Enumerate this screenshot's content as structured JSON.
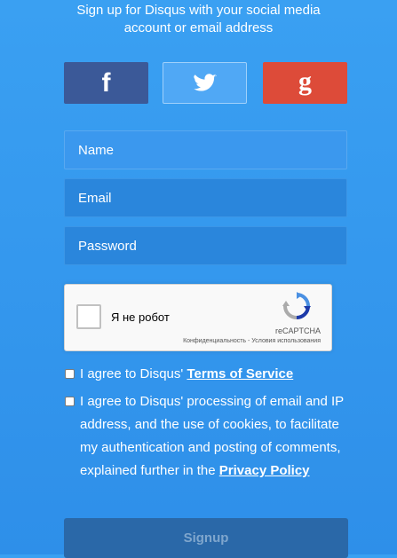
{
  "heading": {
    "line1": "Sign up for Disqus with your social media",
    "line2": "account or email address"
  },
  "social": {
    "facebook": {
      "glyph": "f",
      "icon": "facebook-icon",
      "color": "#3b5998"
    },
    "twitter": {
      "icon": "twitter-bird-icon",
      "color": "#50a8f5"
    },
    "google": {
      "glyph": "g",
      "icon": "google-plus-icon",
      "color": "#dd4b39"
    }
  },
  "form": {
    "name_placeholder": "Name",
    "email_placeholder": "Email",
    "password_placeholder": "Password"
  },
  "captcha": {
    "label": "Я не робот",
    "brand": "reCAPTCHA",
    "links": "Конфиденциальность - Условия использования"
  },
  "agreements": {
    "tos_prefix": "I agree to Disqus' ",
    "tos_link": "Terms of Service",
    "privacy_prefix": "I agree to Disqus' processing of email and IP address, and the use of cookies, to facilitate my authentication and posting of comments, explained further in the ",
    "privacy_link": "Privacy Policy"
  },
  "signup_label": "Signup",
  "colors": {
    "background": "#3aa0f2",
    "signup_button": "#2a68a8"
  }
}
